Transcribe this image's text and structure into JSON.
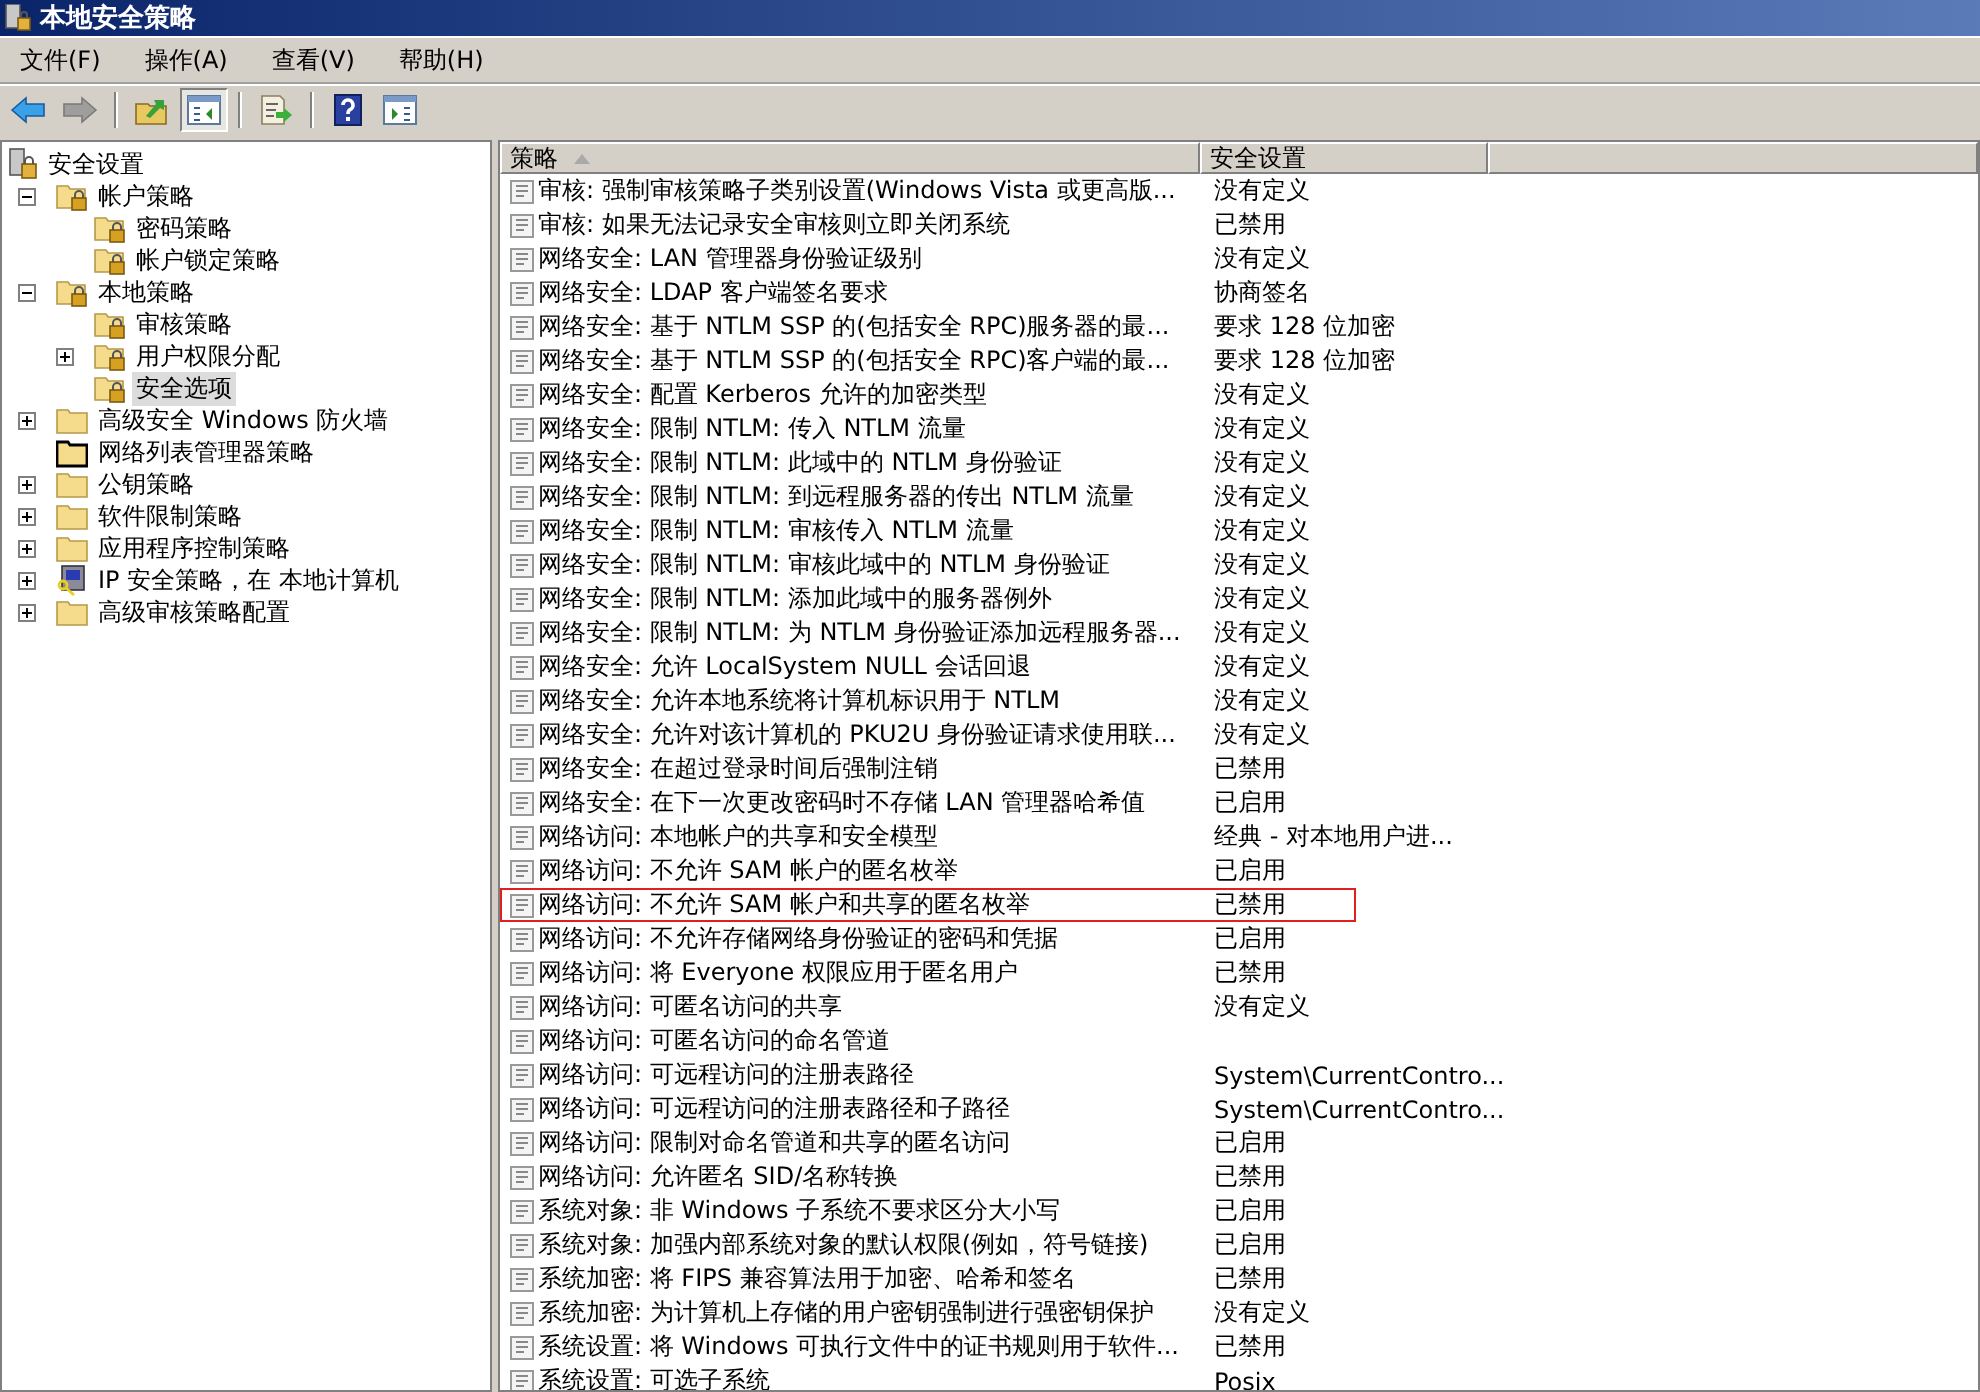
{
  "window": {
    "title": "本地安全策略"
  },
  "menu": [
    "文件(F)",
    "操作(A)",
    "查看(V)",
    "帮助(H)"
  ],
  "toolbar": [
    {
      "kind": "back",
      "disabled": false,
      "pressed": false
    },
    {
      "kind": "forward",
      "disabled": true,
      "pressed": false
    },
    {
      "kind": "separator"
    },
    {
      "kind": "up",
      "disabled": false,
      "pressed": false
    },
    {
      "kind": "tree",
      "disabled": false,
      "pressed": true
    },
    {
      "kind": "separator"
    },
    {
      "kind": "export",
      "disabled": false,
      "pressed": false
    },
    {
      "kind": "separator"
    },
    {
      "kind": "help",
      "disabled": false,
      "pressed": false
    },
    {
      "kind": "pane",
      "disabled": false,
      "pressed": false
    }
  ],
  "tree": [
    {
      "label": "安全设置",
      "kind": "root",
      "selected": false,
      "children": [
        {
          "label": "帐户策略",
          "kind": "lock-folder",
          "expanded": true,
          "selected": false,
          "children": [
            {
              "label": "密码策略",
              "kind": "lock-folder",
              "selected": false
            },
            {
              "label": "帐户锁定策略",
              "kind": "lock-folder",
              "selected": false
            }
          ]
        },
        {
          "label": "本地策略",
          "kind": "lock-folder",
          "expanded": true,
          "selected": false,
          "children": [
            {
              "label": "审核策略",
              "kind": "lock-folder",
              "selected": false
            },
            {
              "label": "用户权限分配",
              "kind": "lock-folder",
              "expanded": false,
              "selected": false
            },
            {
              "label": "安全选项",
              "kind": "lock-folder",
              "selected": true
            }
          ]
        },
        {
          "label": "高级安全 Windows 防火墙",
          "kind": "folder",
          "expanded": false,
          "selected": false
        },
        {
          "label": "网络列表管理器策略",
          "kind": "dark-folder",
          "selected": false
        },
        {
          "label": "公钥策略",
          "kind": "folder",
          "expanded": false,
          "selected": false
        },
        {
          "label": "软件限制策略",
          "kind": "folder",
          "expanded": false,
          "selected": false
        },
        {
          "label": "应用程序控制策略",
          "kind": "folder",
          "expanded": false,
          "selected": false
        },
        {
          "label": "IP 安全策略，在 本地计算机",
          "kind": "ip",
          "expanded": false,
          "selected": false
        },
        {
          "label": "高级审核策略配置",
          "kind": "folder",
          "expanded": false,
          "selected": false
        }
      ]
    }
  ],
  "table": {
    "columns": [
      {
        "label": "策略",
        "sorted": true
      },
      {
        "label": "安全设置",
        "sorted": false
      }
    ],
    "rows": [
      {
        "policy": "审核: 强制审核策略子类别设置(Windows Vista 或更高版...",
        "setting": "没有定义",
        "highlighted": false
      },
      {
        "policy": "审核: 如果无法记录安全审核则立即关闭系统",
        "setting": "已禁用",
        "highlighted": false
      },
      {
        "policy": "网络安全: LAN 管理器身份验证级别",
        "setting": "没有定义",
        "highlighted": false
      },
      {
        "policy": "网络安全: LDAP 客户端签名要求",
        "setting": "协商签名",
        "highlighted": false
      },
      {
        "policy": "网络安全: 基于 NTLM SSP 的(包括安全 RPC)服务器的最...",
        "setting": "要求 128 位加密",
        "highlighted": false
      },
      {
        "policy": "网络安全: 基于 NTLM SSP 的(包括安全 RPC)客户端的最...",
        "setting": "要求 128 位加密",
        "highlighted": false
      },
      {
        "policy": "网络安全: 配置 Kerberos 允许的加密类型",
        "setting": "没有定义",
        "highlighted": false
      },
      {
        "policy": "网络安全: 限制 NTLM: 传入 NTLM 流量",
        "setting": "没有定义",
        "highlighted": false
      },
      {
        "policy": "网络安全: 限制 NTLM: 此域中的 NTLM 身份验证",
        "setting": "没有定义",
        "highlighted": false
      },
      {
        "policy": "网络安全: 限制 NTLM: 到远程服务器的传出 NTLM 流量",
        "setting": "没有定义",
        "highlighted": false
      },
      {
        "policy": "网络安全: 限制 NTLM: 审核传入 NTLM 流量",
        "setting": "没有定义",
        "highlighted": false
      },
      {
        "policy": "网络安全: 限制 NTLM: 审核此域中的 NTLM 身份验证",
        "setting": "没有定义",
        "highlighted": false
      },
      {
        "policy": "网络安全: 限制 NTLM: 添加此域中的服务器例外",
        "setting": "没有定义",
        "highlighted": false
      },
      {
        "policy": "网络安全: 限制 NTLM: 为 NTLM 身份验证添加远程服务器...",
        "setting": "没有定义",
        "highlighted": false
      },
      {
        "policy": "网络安全: 允许 LocalSystem NULL 会话回退",
        "setting": "没有定义",
        "highlighted": false
      },
      {
        "policy": "网络安全: 允许本地系统将计算机标识用于 NTLM",
        "setting": "没有定义",
        "highlighted": false
      },
      {
        "policy": "网络安全: 允许对该计算机的 PKU2U 身份验证请求使用联...",
        "setting": "没有定义",
        "highlighted": false
      },
      {
        "policy": "网络安全: 在超过登录时间后强制注销",
        "setting": "已禁用",
        "highlighted": false
      },
      {
        "policy": "网络安全: 在下一次更改密码时不存储 LAN 管理器哈希值",
        "setting": "已启用",
        "highlighted": false
      },
      {
        "policy": "网络访问: 本地帐户的共享和安全模型",
        "setting": "经典 - 对本地用户进...",
        "highlighted": false
      },
      {
        "policy": "网络访问: 不允许 SAM 帐户的匿名枚举",
        "setting": "已启用",
        "highlighted": false
      },
      {
        "policy": "网络访问: 不允许 SAM 帐户和共享的匿名枚举",
        "setting": "已禁用",
        "highlighted": true
      },
      {
        "policy": "网络访问: 不允许存储网络身份验证的密码和凭据",
        "setting": "已启用",
        "highlighted": false
      },
      {
        "policy": "网络访问: 将 Everyone 权限应用于匿名用户",
        "setting": "已禁用",
        "highlighted": false
      },
      {
        "policy": "网络访问: 可匿名访问的共享",
        "setting": "没有定义",
        "highlighted": false
      },
      {
        "policy": "网络访问: 可匿名访问的命名管道",
        "highlighted": false
      },
      {
        "policy": "网络访问: 可远程访问的注册表路径",
        "setting": "System\\CurrentContro...",
        "highlighted": false
      },
      {
        "policy": "网络访问: 可远程访问的注册表路径和子路径",
        "setting": "System\\CurrentContro...",
        "highlighted": false
      },
      {
        "policy": "网络访问: 限制对命名管道和共享的匿名访问",
        "setting": "已启用",
        "highlighted": false
      },
      {
        "policy": "网络访问: 允许匿名 SID/名称转换",
        "setting": "已禁用",
        "highlighted": false
      },
      {
        "policy": "系统对象: 非 Windows 子系统不要求区分大小写",
        "setting": "已启用",
        "highlighted": false
      },
      {
        "policy": "系统对象: 加强内部系统对象的默认权限(例如，符号链接)",
        "setting": "已启用",
        "highlighted": false
      },
      {
        "policy": "系统加密: 将 FIPS 兼容算法用于加密、哈希和签名",
        "setting": "已禁用",
        "highlighted": false
      },
      {
        "policy": "系统加密: 为计算机上存储的用户密钥强制进行强密钥保护",
        "setting": "没有定义",
        "highlighted": false
      },
      {
        "policy": "系统设置: 将 Windows 可执行文件中的证书规则用于软件...",
        "setting": "已禁用",
        "highlighted": false
      },
      {
        "policy": "系统设置: 可选子系统",
        "setting": "Posix",
        "highlighted": false
      }
    ]
  }
}
